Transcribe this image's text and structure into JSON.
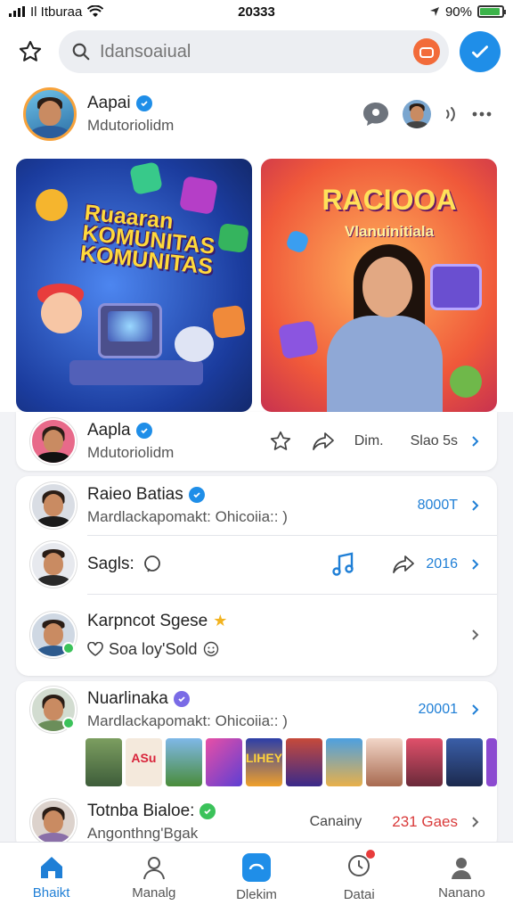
{
  "status_bar": {
    "carrier": "Il Itburaa",
    "time": "20333",
    "battery": "90%",
    "battery_level": 0.9
  },
  "search": {
    "placeholder": "Idansoaiual"
  },
  "profile_header": {
    "name": "Aapai",
    "subtitle": "Mdutoriolidm"
  },
  "banners": [
    {
      "title": "Ruaaran KOMUNITAS KOMUNITAS",
      "colors": [
        "#4d86f0",
        "#1b3c9e"
      ]
    },
    {
      "title": "RACIOOA",
      "subtitle": "Vlanuinitiala",
      "colors": [
        "#ffb45c",
        "#f0593a"
      ]
    }
  ],
  "rows": [
    {
      "name": "Aapla",
      "subtitle": "Mdutoriolidm",
      "label": "Dim.",
      "meta": "Slao 5s"
    },
    {
      "name": "Raieo Batias",
      "subtitle": "Mardlackapomakt: Ohicoiia:: )",
      "meta": "8000T"
    },
    {
      "name": "Sagls:",
      "meta": "2016"
    },
    {
      "name": "Karpncot Sgese",
      "like_text": "Soa loy'Sold"
    }
  ],
  "card3": {
    "name": "Nuarlinaka",
    "subtitle": "Mardlackapomakt: Ohicoiia:: )",
    "meta": "20001",
    "thumb_label_1": "ASu",
    "thumb_label_2": "LIHEY"
  },
  "last_row": {
    "name": "Totnba Bialoe:",
    "subtitle": "Angonthng'Bgak",
    "label": "Canainy",
    "meta": "231 Gaes"
  },
  "nav": [
    {
      "label": "Bhaikt"
    },
    {
      "label": "Manalg"
    },
    {
      "label": "Dlekim"
    },
    {
      "label": "Datai"
    },
    {
      "label": "Nanano"
    }
  ],
  "colors": {
    "accent": "#1f8ee8",
    "orange": "#f26b3a",
    "red": "#d93a3a",
    "green": "#3bc25a"
  }
}
